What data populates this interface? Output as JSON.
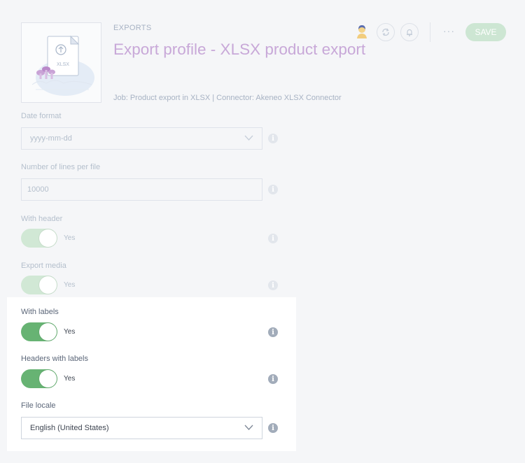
{
  "header": {
    "breadcrumb": "EXPORTS",
    "title": "Export profile - XLSX product export",
    "subtitle": "Job: Product export in XLSX | Connector: Akeneo XLSX Connector",
    "illustration_label": "XLSX",
    "more_label": "···",
    "save_label": "SAVE"
  },
  "form": {
    "date_format": {
      "label": "Date format",
      "value": "yyyy-mm-dd"
    },
    "lines_per_file": {
      "label": "Number of lines per file",
      "value": "10000"
    },
    "with_header": {
      "label": "With header",
      "state": "Yes"
    },
    "export_media": {
      "label": "Export media",
      "state": "Yes"
    },
    "with_labels": {
      "label": "With labels",
      "state": "Yes"
    },
    "headers_with_labels": {
      "label": "Headers with labels",
      "state": "Yes"
    },
    "file_locale": {
      "label": "File locale",
      "value": "English (United States)"
    }
  },
  "colors": {
    "accent_green": "#67b373",
    "title_purple": "#c8a8d8",
    "text": "#67768a"
  }
}
